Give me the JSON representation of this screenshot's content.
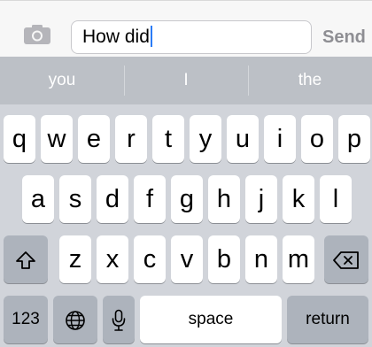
{
  "compose": {
    "camera_icon": "camera-icon",
    "message_text": "How did",
    "send_label": "Send"
  },
  "predictions": [
    "you",
    "I",
    "the"
  ],
  "keyboard": {
    "row1": [
      "q",
      "w",
      "e",
      "r",
      "t",
      "y",
      "u",
      "i",
      "o",
      "p"
    ],
    "row2": [
      "a",
      "s",
      "d",
      "f",
      "g",
      "h",
      "j",
      "k",
      "l"
    ],
    "row3": [
      "z",
      "x",
      "c",
      "v",
      "b",
      "n",
      "m"
    ],
    "numbers_label": "123",
    "space_label": "space",
    "return_label": "return"
  },
  "colors": {
    "caret": "#2a7bf6",
    "send_disabled": "#8e8e93",
    "key": "#ffffff",
    "dark_key": "#adb3bc",
    "keyboard_bg": "#d1d4da"
  }
}
